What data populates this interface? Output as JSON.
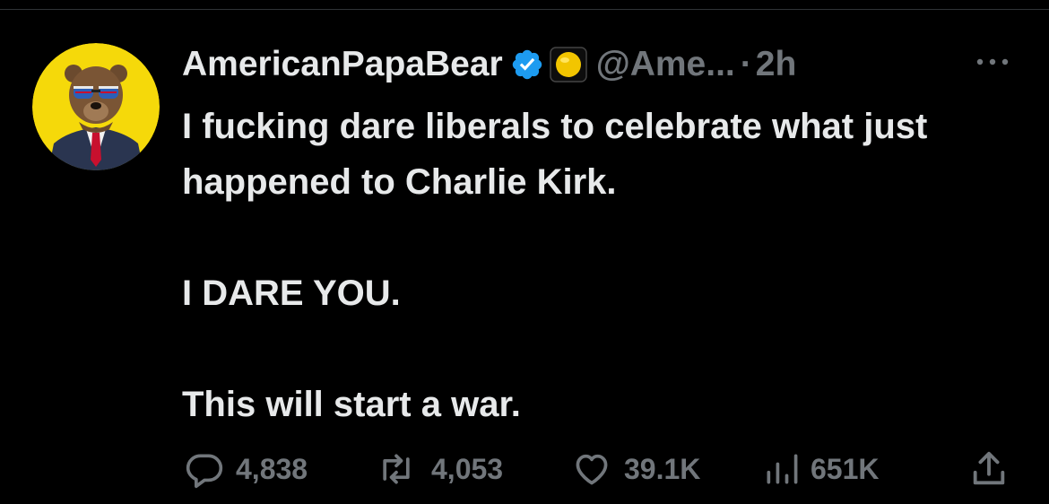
{
  "tweet": {
    "author": {
      "display_name": "AmericanPapaBear",
      "handle": "@Ame...",
      "verified": true
    },
    "separator": "·",
    "timestamp": "2h",
    "body": {
      "line1": "I fucking dare liberals to celebrate what just happened to Charlie Kirk.",
      "line2": "I DARE YOU.",
      "line3": "This will start a war."
    },
    "stats": {
      "replies": "4,838",
      "reposts": "4,053",
      "likes": "39.1K",
      "views": "651K"
    }
  },
  "colors": {
    "background": "#000000",
    "text_primary": "#e7e9ea",
    "text_secondary": "#71767b",
    "verified_blue": "#1d9bf0",
    "avatar_bg": "#f5d90a"
  },
  "icons": {
    "more": "more-dots-icon",
    "verified": "verified-badge-icon",
    "affiliation": "affiliate-badge-icon",
    "reply": "reply-icon",
    "repost": "repost-icon",
    "like": "heart-icon",
    "views": "views-chart-icon",
    "share": "share-icon"
  }
}
